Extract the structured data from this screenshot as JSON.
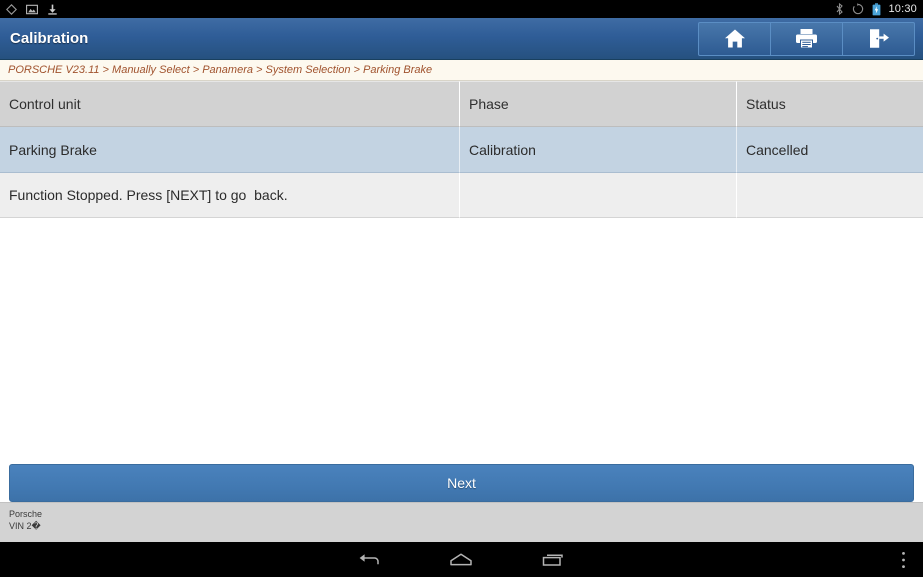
{
  "statusbar": {
    "left_icons": [
      "location-outline-icon",
      "screenshot-icon",
      "download-icon"
    ],
    "right_icons": [
      "bluetooth-icon",
      "rotation-lock-icon",
      "battery-icon"
    ],
    "clock": "10:30"
  },
  "titlebar": {
    "title": "Calibration",
    "buttons": [
      {
        "name": "home-button",
        "icon": "home-icon"
      },
      {
        "name": "print-button",
        "icon": "printer-icon"
      },
      {
        "name": "exit-button",
        "icon": "exit-icon"
      }
    ]
  },
  "breadcrumb": {
    "text": "PORSCHE V23.11 > Manually Select > Panamera > System Selection > Parking Brake"
  },
  "table": {
    "headers": [
      "Control unit",
      "Phase",
      "Status"
    ],
    "rows": [
      {
        "control_unit": "Parking Brake",
        "phase": "Calibration",
        "status": "Cancelled"
      },
      {
        "control_unit": "Function Stopped. Press [NEXT] to go  back.",
        "phase": "",
        "status": ""
      }
    ]
  },
  "actions": {
    "next_label": "Next"
  },
  "footer": {
    "vehicle": "Porsche",
    "vin": "VIN 2�"
  },
  "navbar": {
    "back": "back-icon",
    "home": "home-icon",
    "recents": "recents-icon",
    "menu": "overflow-menu-icon"
  },
  "colors": {
    "accent_blue": "#3d72a9",
    "title_blue": "#2f5d97",
    "row_highlight": "#c3d3e2",
    "header_gray": "#d2d2d2",
    "breadcrumb_text": "#a0522d",
    "footer_gray": "#d3d3d3"
  }
}
